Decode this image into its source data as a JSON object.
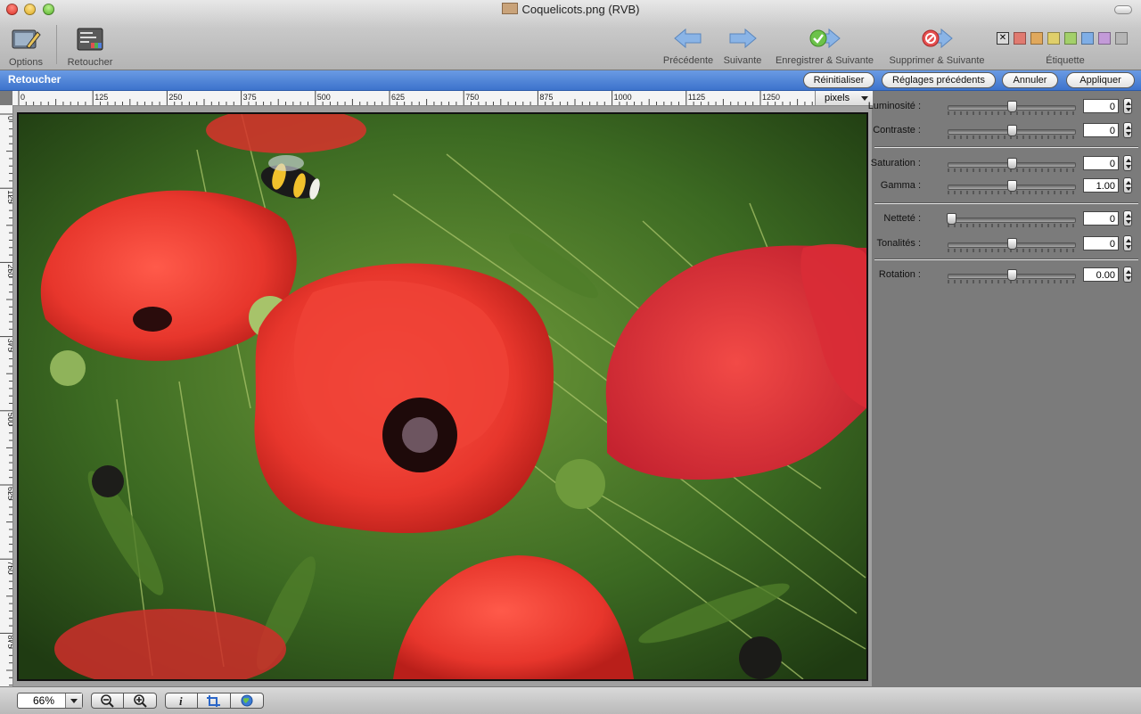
{
  "window": {
    "title": "Coquelicots.png (RVB)"
  },
  "toolbar": {
    "options_label": "Options",
    "retoucher_label": "Retoucher",
    "previous_label": "Précédente",
    "next_label": "Suivante",
    "save_next_label": "Enregistrer & Suivante",
    "delete_next_label": "Supprimer & Suivante",
    "label_title": "Étiquette",
    "label_colors": [
      "#d9d9d9",
      "#e07a70",
      "#e0a85c",
      "#e0cf6a",
      "#a3d06a",
      "#7faee6",
      "#c39ad8",
      "#b5b5b5"
    ]
  },
  "panel_bar": {
    "title": "Retoucher",
    "reset_label": "Réinitialiser",
    "previous_settings_label": "Réglages précédents",
    "cancel_label": "Annuler",
    "apply_label": "Appliquer"
  },
  "ruler": {
    "units": "pixels",
    "top_ticks": [
      "0",
      "125",
      "250",
      "375",
      "500",
      "625",
      "750",
      "875",
      "1000",
      "1125",
      "1250"
    ],
    "left_ticks": [
      "0",
      "125",
      "250",
      "375",
      "500",
      "625",
      "750",
      "875"
    ]
  },
  "adjustments": {
    "brightness": {
      "label": "Luminosité :",
      "value": "0",
      "level": 0.5
    },
    "contrast": {
      "label": "Contraste :",
      "value": "0",
      "level": 0.5
    },
    "saturation": {
      "label": "Saturation :",
      "value": "0",
      "level": 0.5
    },
    "gamma": {
      "label": "Gamma :",
      "value": "1.00",
      "level": 0.5
    },
    "sharpness": {
      "label": "Netteté :",
      "value": "0",
      "level": 0.0
    },
    "hue": {
      "label": "Tonalités :",
      "value": "0",
      "level": 0.5
    },
    "rotation": {
      "label": "Rotation :",
      "value": "0.00",
      "level": 0.5
    }
  },
  "bottom": {
    "zoom_value": "66%"
  }
}
